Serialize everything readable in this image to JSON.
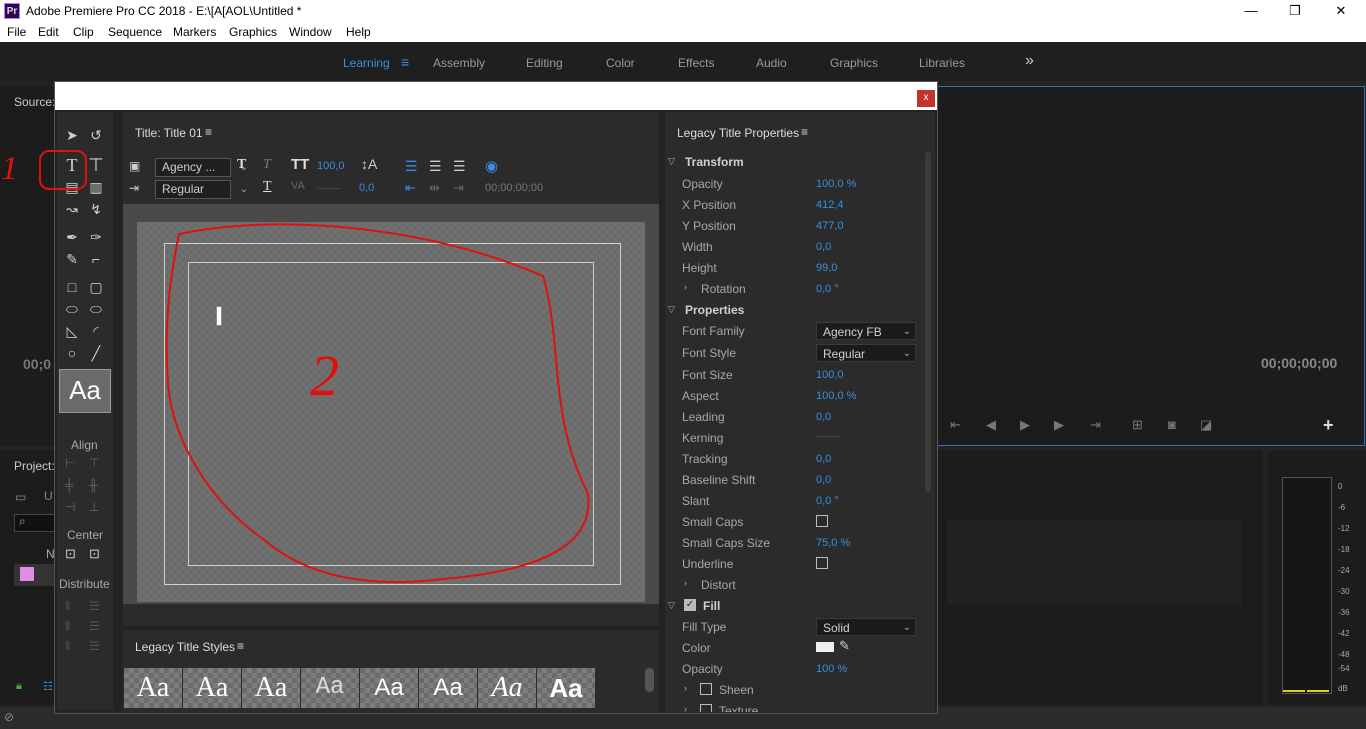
{
  "window": {
    "title": "Adobe Premiere Pro CC 2018 - E:\\[A[AOL\\Untitled *",
    "app_icon": "Pr",
    "minimize": "—",
    "restore": "❐",
    "close": "✕"
  },
  "menu": [
    "File",
    "Edit",
    "Clip",
    "Sequence",
    "Markers",
    "Graphics",
    "Window",
    "Help"
  ],
  "workspaces": {
    "items": [
      "Learning",
      "Assembly",
      "Editing",
      "Color",
      "Effects",
      "Audio",
      "Graphics",
      "Libraries"
    ],
    "active": "Learning",
    "more": "»",
    "menu_icon": "≡"
  },
  "source_panel": {
    "label": "Source:",
    "timecode_left": "00;0",
    "timecode_right": "00;00;00;00"
  },
  "project_panel": {
    "label": "Project:",
    "col": "N",
    "item": "U"
  },
  "audio_meter": {
    "scale": [
      "0",
      "-6",
      "-12",
      "-18",
      "-24",
      "-30",
      "-36",
      "-42",
      "-48",
      "-54",
      "dB"
    ]
  },
  "dialog": {
    "close": "x",
    "title_panel": {
      "label": "Title: Title 01",
      "menu": "≡"
    },
    "toolbar": {
      "font": "Agency ...",
      "style": "Regular",
      "font_size": "100,0",
      "kerning": "0,0",
      "leading_dash": "---------",
      "timecode": "00;00;00;00"
    },
    "tools_panel": {
      "align_label": "Align",
      "center_label": "Center",
      "distribute_label": "Distribute",
      "sample_text": "Aa"
    },
    "annotations": {
      "one": "1",
      "two": "2"
    },
    "styles_panel": {
      "label": "Legacy Title Styles",
      "menu": "≡",
      "swatches": [
        "Aa",
        "Aa",
        "Aa",
        "Aa",
        "Aa",
        "Aa",
        "Aa",
        "Aa"
      ]
    },
    "properties": {
      "label": "Legacy Title Properties",
      "menu": "≡",
      "transform": "Transform",
      "opacity_label": "Opacity",
      "opacity": "100,0 %",
      "xpos_label": "X Position",
      "xpos": "412,4",
      "ypos_label": "Y Position",
      "ypos": "477,0",
      "width_label": "Width",
      "width": "0,0",
      "height_label": "Height",
      "height": "99,0",
      "rotation_label": "Rotation",
      "rotation": "0,0 °",
      "properties": "Properties",
      "font_family_label": "Font Family",
      "font_family": "Agency FB",
      "font_style_label": "Font Style",
      "font_style": "Regular",
      "font_size_label": "Font Size",
      "font_size": "100,0",
      "aspect_label": "Aspect",
      "aspect": "100,0 %",
      "leading_label": "Leading",
      "leading": "0,0",
      "kerning_label": "Kerning",
      "kerning": "---------",
      "tracking_label": "Tracking",
      "tracking": "0,0",
      "baseline_label": "Baseline Shift",
      "baseline": "0,0",
      "slant_label": "Slant",
      "slant": "0,0 °",
      "smallcaps_label": "Small Caps",
      "smallcaps_size_label": "Small Caps Size",
      "smallcaps_size": "75,0 %",
      "underline_label": "Underline",
      "distort_label": "Distort",
      "fill": "Fill",
      "fill_type_label": "Fill Type",
      "fill_type": "Solid",
      "color_label": "Color",
      "fill_opacity_label": "Opacity",
      "fill_opacity": "100 %",
      "sheen_label": "Sheen",
      "texture_label": "Texture"
    }
  },
  "colors": {
    "accent": "#3b8de0",
    "annotation": "#e01010",
    "close": "#c4322c"
  }
}
